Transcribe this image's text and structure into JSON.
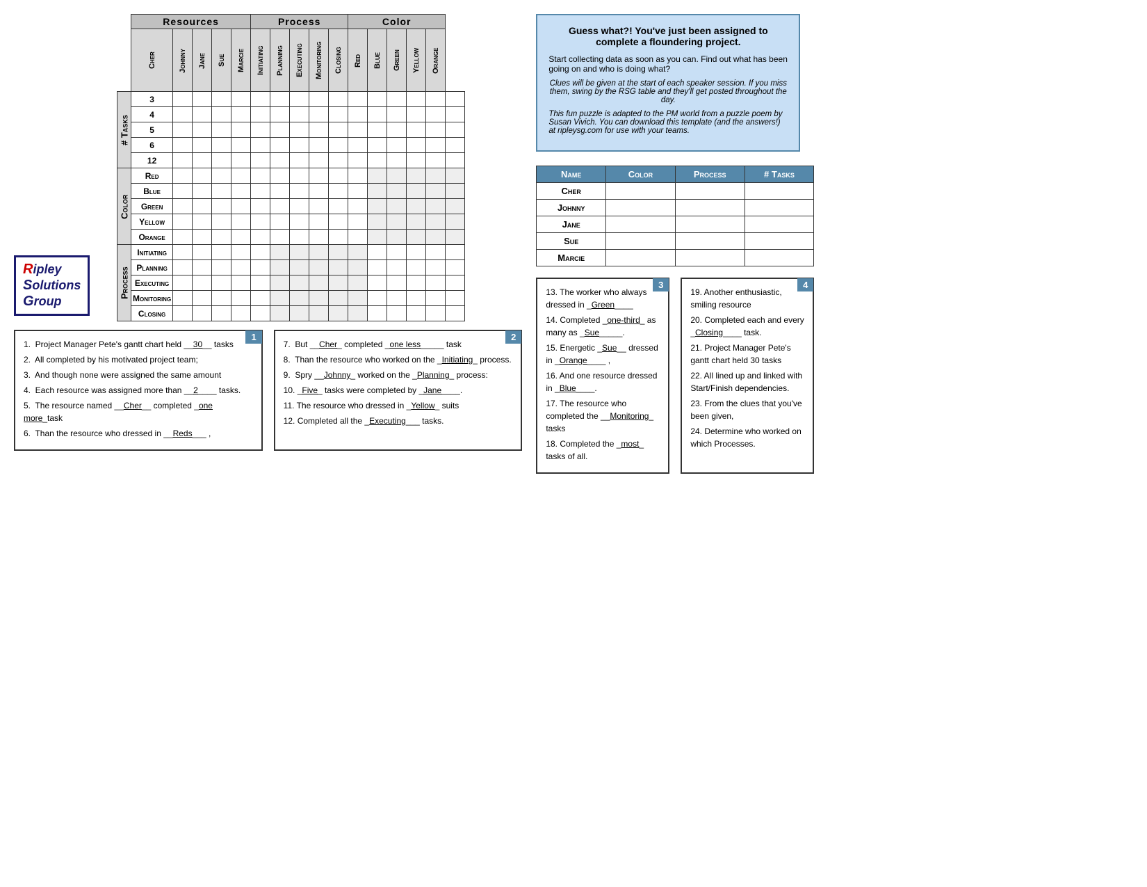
{
  "logo": {
    "line1": "ipley",
    "line2": "olutions",
    "line3": "roup",
    "r": "R",
    "s": "S",
    "g": "G"
  },
  "infoBox": {
    "title": "Guess what?! You've just been assigned to complete a floundering project.",
    "para1": "Start collecting data as soon as you can.  Find out what has been going on and who is doing what?",
    "italic1": "Clues will be given at the start of each speaker session.  If you miss them, swing by the RSG table and they'll get posted throughout the day.",
    "italic2": "This fun puzzle is adapted to the PM world from a puzzle poem by Susan Vivich.  You can download this template (and the answers!) at ripleysg.com for use with your teams."
  },
  "gridHeaders": {
    "resources": "Resources",
    "process": "Process",
    "color": "Color"
  },
  "resourceCols": [
    "Cher",
    "Johnny",
    "Jane",
    "Sue",
    "Marcie"
  ],
  "processCols": [
    "Initiating",
    "Planning",
    "Executing",
    "Monitoring",
    "Closing"
  ],
  "colorCols": [
    "Red",
    "Blue",
    "Green",
    "Yellow",
    "Orange"
  ],
  "taskRows": [
    "3",
    "4",
    "5",
    "6",
    "12"
  ],
  "colorRows": [
    "Red",
    "Blue",
    "Green",
    "Yellow",
    "Orange"
  ],
  "processRows": [
    "Initiating",
    "Planning",
    "Executing",
    "Monitoring",
    "Closing"
  ],
  "sideLabels": {
    "tasks": "# Tasks",
    "color": "Color",
    "process": "Process"
  },
  "answerTable": {
    "headers": [
      "Name",
      "Color",
      "Process",
      "# Tasks"
    ],
    "rows": [
      {
        "name": "Cher",
        "color": "",
        "process": "",
        "tasks": ""
      },
      {
        "name": "Johnny",
        "color": "",
        "process": "",
        "tasks": ""
      },
      {
        "name": "Jane",
        "color": "",
        "process": "",
        "tasks": ""
      },
      {
        "name": "Sue",
        "color": "",
        "process": "",
        "tasks": ""
      },
      {
        "name": "Marcie",
        "color": "",
        "process": "",
        "tasks": ""
      }
    ]
  },
  "clues": {
    "box1": {
      "number": "1",
      "lines": [
        "1.  Project Manager Pete's gantt chart held __<u>30</u>__ tasks",
        "2.  All completed by his motivated project team;",
        "3.  And though none were assigned the same amount",
        "4.  Each resource was assigned more than __<u>2</u>____ tasks.",
        "5.  The resource named __<u>Cher</u>__ completed _<u>one more</u>_task",
        "6.  Than the resource who dressed in __<u>Reds</u>___ ,"
      ]
    },
    "box2": {
      "number": "2",
      "lines": [
        "7.  But __<u>Cher</u>_ completed _<u>one less</u>_____ task",
        "8.  Than the resource who worked on the _<u>Initiating</u>_ process.",
        "9.  Spry  __<u>Johnny</u>_ worked on the _<u>Planning</u>_ process:",
        "10. _<u>Five</u>_ tasks were completed by _<u>Jane</u>____.",
        "11. The resource who dressed in _<u>Yellow</u>_ suits",
        "12. Completed all the _<u>Executing</u>___ tasks."
      ]
    },
    "box3": {
      "number": "3",
      "lines": [
        "13. The worker who always dressed in _<u>Green</u>____",
        "14. Completed _<u>one-third</u>_ as many as _<u>Sue</u>_____.",
        "15. Energetic _<u>Sue</u>__ dressed in _<u>Orange</u>____ ,",
        "16. And one resource dressed in _<u>Blue</u>____.",
        "17. The resource who completed the __<u>Monitoring</u>_ tasks",
        "18. Completed the _<u>most</u>_ tasks of all."
      ]
    },
    "box4": {
      "number": "4",
      "lines": [
        "19. Another enthusiastic, smiling resource",
        "20. Completed each and every _<u>Closing</u>____ task.",
        "21. Project Manager Pete's gantt chart held 30 tasks",
        "22. All lined up and linked with Start/Finish dependencies.",
        "23. From the clues that you've been given,",
        "24. Determine who worked on which Processes."
      ]
    }
  }
}
